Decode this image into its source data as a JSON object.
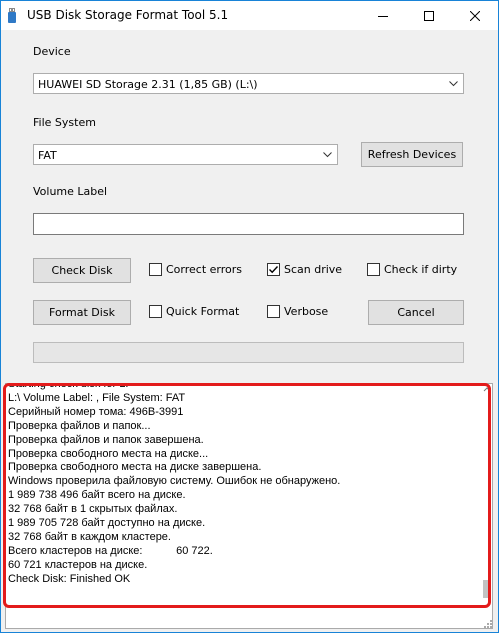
{
  "window": {
    "title": "USB Disk Storage Format Tool 5.1",
    "controls": [
      "minimize",
      "maximize",
      "close"
    ]
  },
  "device": {
    "label": "Device",
    "selected": "HUAWEI  SD Storage  2.31 (1,85 GB) (L:\\)"
  },
  "file_system": {
    "label": "File System",
    "selected": "FAT",
    "refresh_label": "Refresh Devices"
  },
  "volume_label": {
    "label": "Volume Label",
    "value": ""
  },
  "buttons": {
    "check_disk": "Check Disk",
    "format_disk": "Format Disk",
    "cancel": "Cancel"
  },
  "options": {
    "correct_errors": {
      "label": "Correct errors",
      "checked": false
    },
    "scan_drive": {
      "label": "Scan drive",
      "checked": true
    },
    "check_if_dirty": {
      "label": "Check if dirty",
      "checked": false
    },
    "quick_format": {
      "label": "Quick Format",
      "checked": false
    },
    "verbose": {
      "label": "Verbose",
      "checked": false
    }
  },
  "progress": {
    "value": 0
  },
  "log": {
    "lines": [
      "Starting check disk for L:",
      "L:\\ Volume Label: , File System: FAT",
      "Серийный номер тома: 496B-3991",
      "Проверка файлов и папок...",
      "Проверка файлов и папок завершена.",
      "Проверка свободного места на диске...",
      "Проверка свободного места на диске завершена.",
      "Windows проверила файловую систему. Ошибок не обнаружено.",
      "1 989 738 496 байт всего на диске.",
      "32 768 байт в 1 скрытых файлах.",
      "1 989 705 728 байт доступно на диске.",
      "32 768 байт в каждом кластере.",
      "Всего кластеров на диске:           60 722.",
      "60 721 кластеров на диске.",
      "Check Disk: Finished OK"
    ]
  },
  "colors": {
    "accent_border": "#1883d7",
    "highlight": "#e31b1b"
  }
}
